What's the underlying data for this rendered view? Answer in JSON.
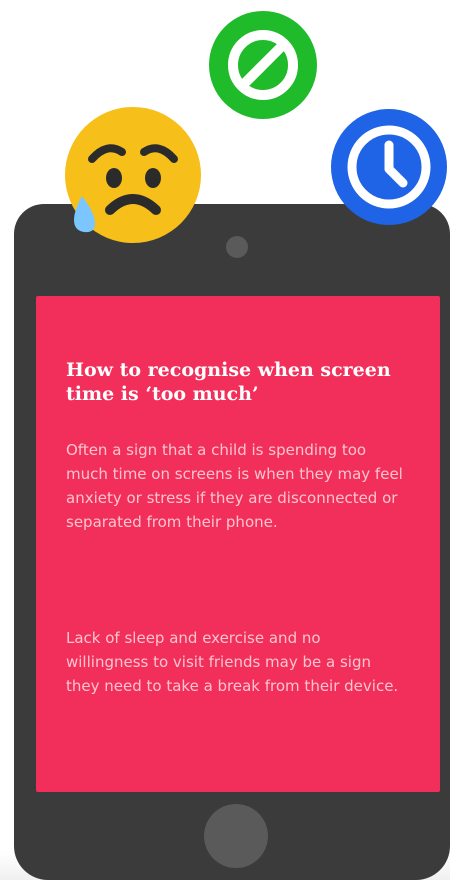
{
  "colors": {
    "phone_body": "#3b3b3b",
    "screen_background": "#f12f5a",
    "title_text": "#ffffff",
    "body_text": "#ffd1da",
    "blocked_icon": "#1fbb2a",
    "clock_icon": "#1f63e6",
    "emoji_face": "#f7bf19"
  },
  "icons": {
    "emoji": "worried-face-icon",
    "blocked": "blocked-icon",
    "clock": "clock-icon"
  },
  "screen": {
    "title": "How to recognise when screen time is ‘too much’",
    "paragraph_1": "Often a sign that a child is spending too much time on screens is when they may feel anxiety or stress if they are disconnected or separated from their phone.",
    "paragraph_2": "Lack of sleep and exercise and no willingness to visit friends may be a sign they need to take a break from their device."
  }
}
